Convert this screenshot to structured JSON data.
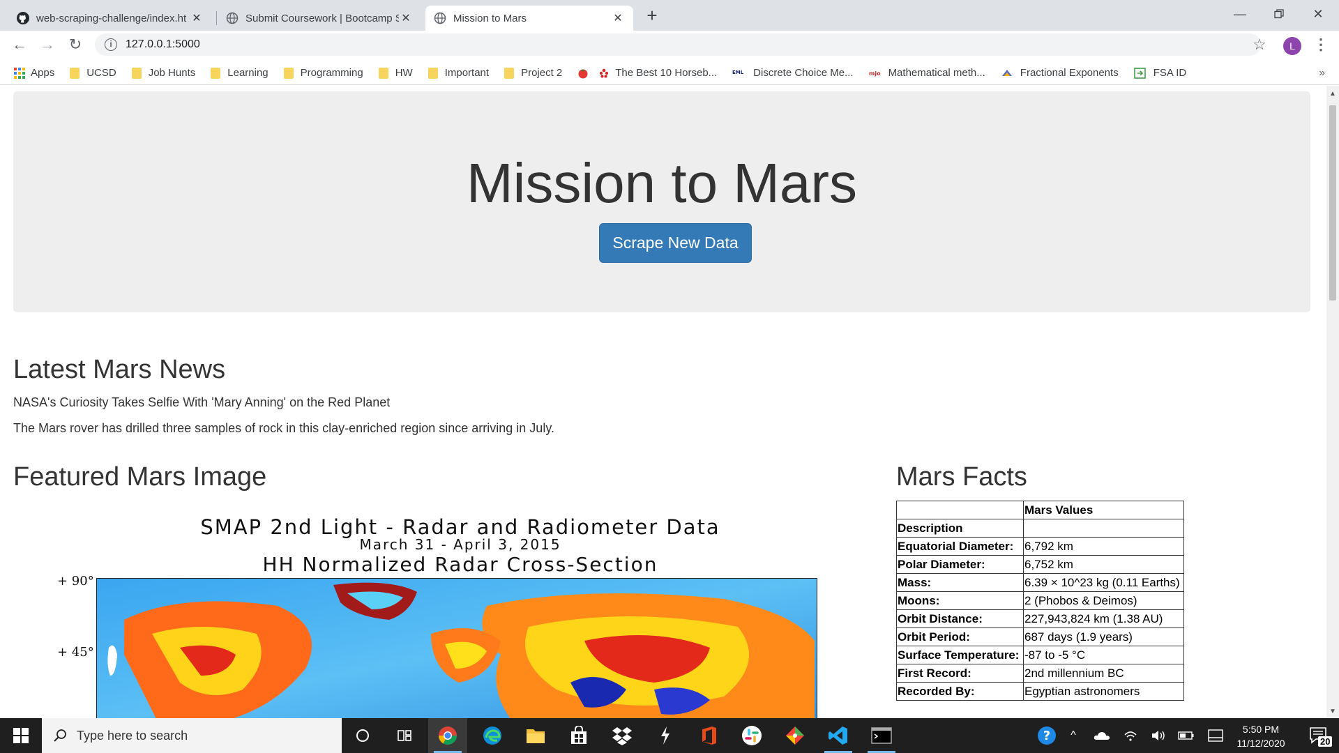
{
  "browser": {
    "tabs": [
      {
        "title": "web-scraping-challenge/index.ht",
        "icon": "github-icon"
      },
      {
        "title": "Submit Coursework | Bootcamp S",
        "icon": "globe-icon"
      },
      {
        "title": "Mission to Mars",
        "icon": "globe-icon"
      }
    ],
    "url": "127.0.0.1:5000",
    "profile_initial": "L",
    "bookmarks": [
      {
        "label": "Apps",
        "icon": "apps-grid-icon"
      },
      {
        "label": "UCSD",
        "icon": "folder-icon"
      },
      {
        "label": "Job Hunts",
        "icon": "folder-icon"
      },
      {
        "label": "Learning",
        "icon": "folder-icon"
      },
      {
        "label": "Programming",
        "icon": "folder-icon"
      },
      {
        "label": "HW",
        "icon": "folder-icon"
      },
      {
        "label": "Important",
        "icon": "folder-icon"
      },
      {
        "label": "Project 2",
        "icon": "folder-icon"
      },
      {
        "label": "",
        "icon": "tomato-icon"
      },
      {
        "label": "The Best 10 Horseb...",
        "icon": "yelp-icon"
      },
      {
        "label": "Discrete Choice Me...",
        "icon": "site-icon"
      },
      {
        "label": "Mathematical meth...",
        "icon": "mjo-icon"
      },
      {
        "label": "Fractional Exponents",
        "icon": "math-icon"
      },
      {
        "label": "FSA ID",
        "icon": "fsa-icon"
      }
    ]
  },
  "page": {
    "title": "Mission to Mars",
    "scrape_button": "Scrape New Data",
    "news": {
      "heading": "Latest Mars News",
      "title": "NASA's Curiosity Takes Selfie With 'Mary Anning' on the Red Planet",
      "paragraph": "The Mars rover has drilled three samples of rock in this clay-enriched region since arriving in July."
    },
    "featured": {
      "heading": "Featured Mars Image",
      "image_title": "SMAP 2nd Light - Radar and Radiometer Data",
      "image_date": "March 31 - April 3, 2015",
      "image_subtitle": "HH Normalized Radar Cross-Section",
      "lat_labels": [
        "+ 90°",
        "+ 45°"
      ]
    },
    "facts": {
      "heading": "Mars Facts",
      "column_header": "Mars Values",
      "description_label": "Description",
      "rows": [
        {
          "label": "Equatorial Diameter:",
          "value": "6,792 km"
        },
        {
          "label": "Polar Diameter:",
          "value": "6,752 km"
        },
        {
          "label": "Mass:",
          "value": "6.39 × 10^23 kg (0.11 Earths)"
        },
        {
          "label": "Moons:",
          "value": "2 (Phobos & Deimos)"
        },
        {
          "label": "Orbit Distance:",
          "value": "227,943,824 km (1.38 AU)"
        },
        {
          "label": "Orbit Period:",
          "value": "687 days (1.9 years)"
        },
        {
          "label": "Surface Temperature:",
          "value": "-87 to -5 °C"
        },
        {
          "label": "First Record:",
          "value": "2nd millennium BC"
        },
        {
          "label": "Recorded By:",
          "value": "Egyptian astronomers"
        }
      ]
    }
  },
  "taskbar": {
    "search_placeholder": "Type here to search",
    "time": "5:50 PM",
    "date": "11/12/2020",
    "notification_count": "20"
  }
}
